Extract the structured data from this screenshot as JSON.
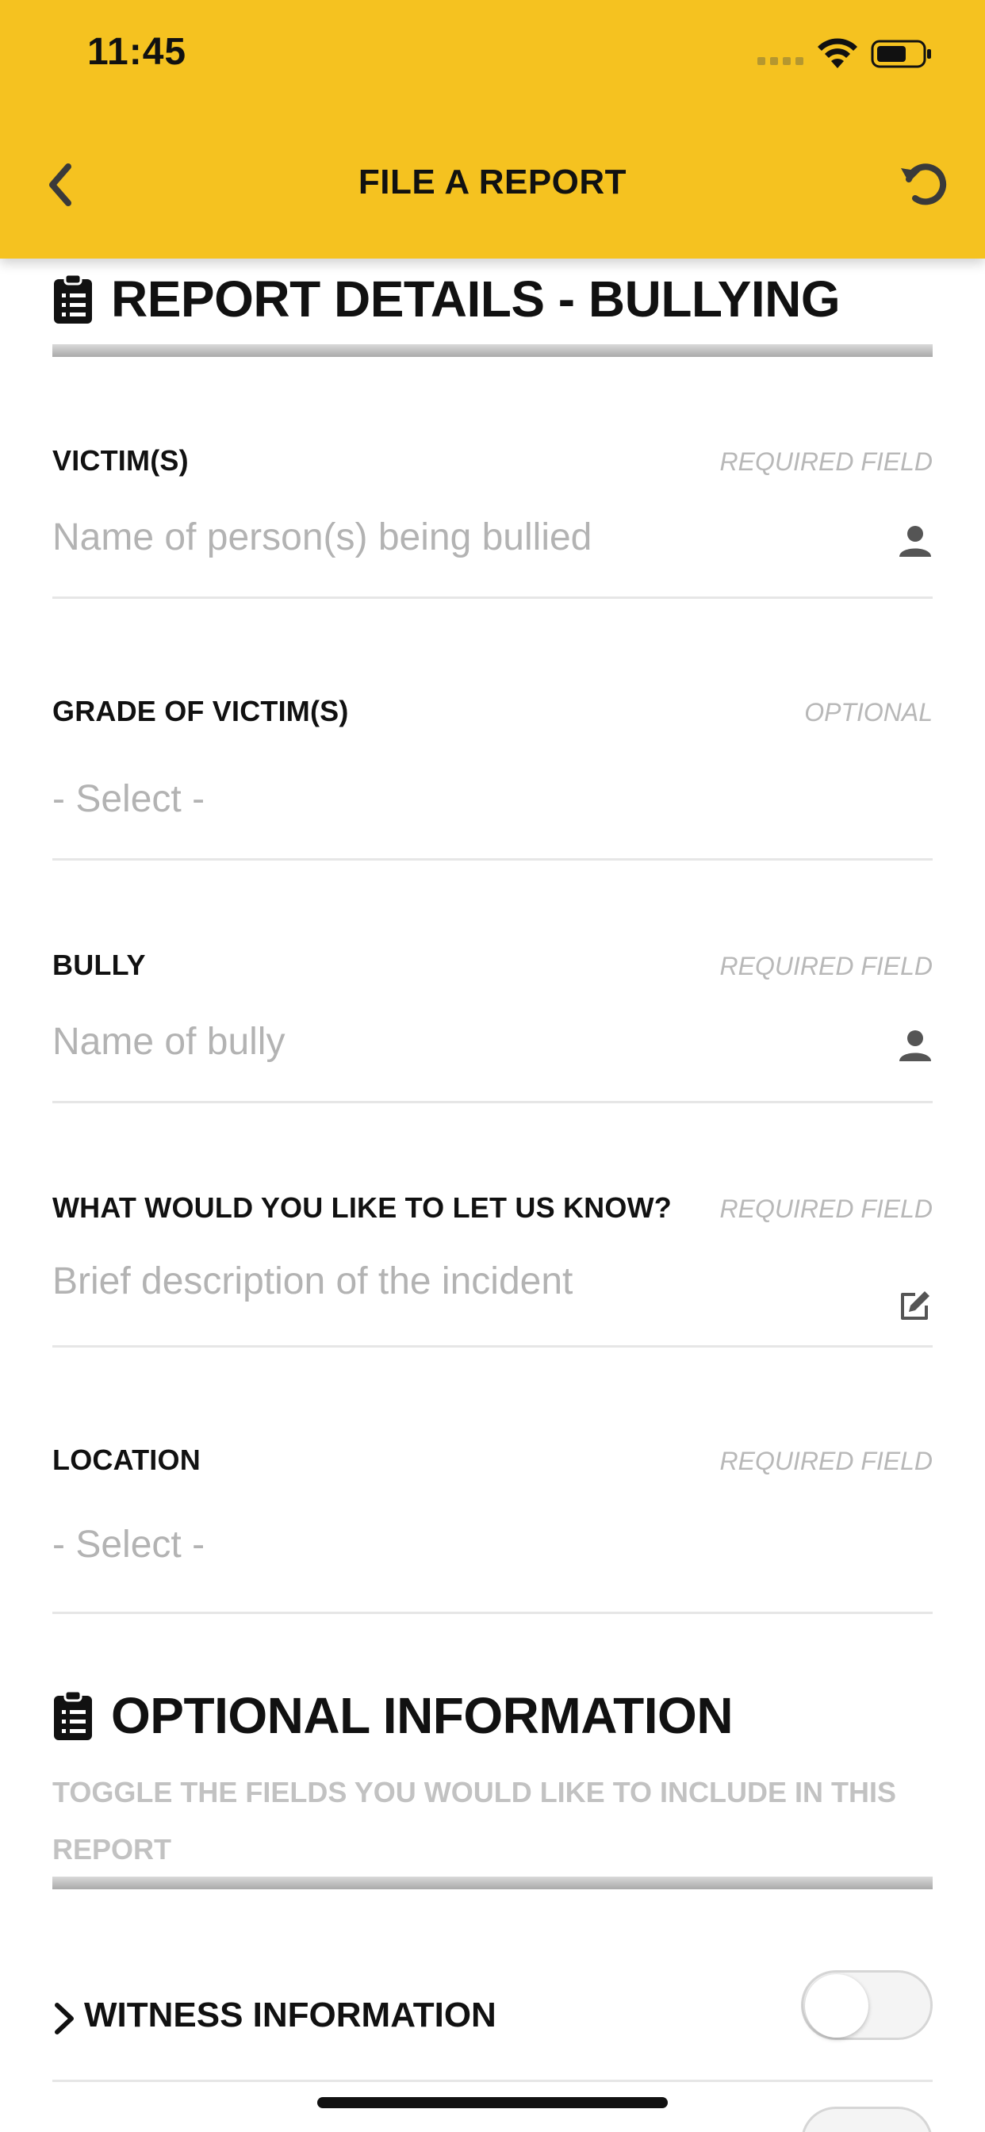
{
  "status_bar": {
    "time": "11:45"
  },
  "nav": {
    "title": "FILE A REPORT"
  },
  "section1": {
    "title": "REPORT DETAILS - BULLYING"
  },
  "fields": [
    {
      "label": "VICTIM(S)",
      "requirement": "REQUIRED FIELD",
      "placeholder": "Name of person(s) being bullied",
      "icon": "person-icon"
    },
    {
      "label": "GRADE OF VICTIM(S)",
      "requirement": "OPTIONAL",
      "placeholder": "- Select -"
    },
    {
      "label": "BULLY",
      "requirement": "REQUIRED FIELD",
      "placeholder": "Name of bully",
      "icon": "person-icon"
    },
    {
      "label": "WHAT WOULD YOU LIKE TO LET US KNOW?",
      "requirement": "REQUIRED FIELD",
      "placeholder": "Brief description of the incident",
      "icon": "edit-icon"
    },
    {
      "label": "LOCATION",
      "requirement": "REQUIRED FIELD",
      "placeholder": "- Select -"
    }
  ],
  "section2": {
    "title": "OPTIONAL INFORMATION",
    "subtitle": "TOGGLE THE FIELDS YOU WOULD LIKE TO INCLUDE IN THIS REPORT"
  },
  "toggles": [
    {
      "label": "WITNESS INFORMATION",
      "on": false
    }
  ],
  "colors": {
    "header_bg": "#F5C220",
    "text": "#111111",
    "placeholder": "#B3B3B3",
    "hint": "#B8B8B8"
  }
}
